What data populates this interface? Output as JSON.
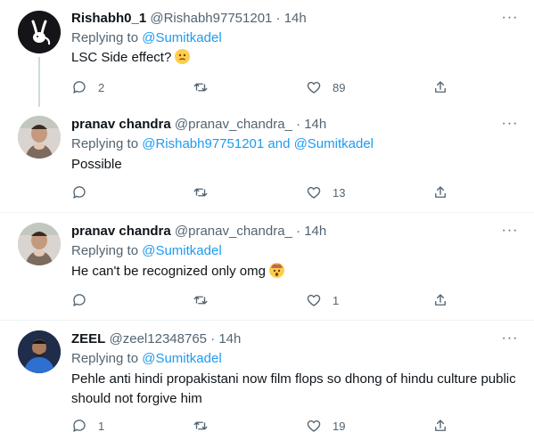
{
  "tweets": [
    {
      "name": "Rishabh0_1",
      "handle": "@Rishabh97751201",
      "dot": "·",
      "time": "14h",
      "replying_prefix": "Replying to ",
      "replying_to": "@Sumitkadel",
      "text": "LSC Side effect?",
      "emoji": "confused-face",
      "reply_count": "2",
      "retweet_count": "",
      "like_count": "89"
    },
    {
      "name": "pranav chandra",
      "handle": "@pranav_chandra_",
      "dot": "·",
      "time": "14h",
      "replying_prefix": "Replying to ",
      "replying_to": "@Rishabh97751201 and @Sumitkadel",
      "text": "Possible",
      "reply_count": "",
      "retweet_count": "",
      "like_count": "13"
    },
    {
      "name": "pranav chandra",
      "handle": "@pranav_chandra_",
      "dot": "·",
      "time": "14h",
      "replying_prefix": "Replying to ",
      "replying_to": "@Sumitkadel",
      "text": "He can't be recognized only omg",
      "emoji": "exploding-head",
      "reply_count": "",
      "retweet_count": "",
      "like_count": "1"
    },
    {
      "name": "ZEEL",
      "handle": "@zeel12348765",
      "dot": "·",
      "time": "14h",
      "replying_prefix": "Replying to ",
      "replying_to": "@Sumitkadel",
      "text": "Pehle anti hindi propakistani now film flops so dhong of hindu culture public should not forgive him",
      "reply_count": "1",
      "retweet_count": "",
      "like_count": "19"
    }
  ],
  "more_label": "···",
  "colors": {
    "link": "#1d9bf0",
    "muted": "#536471",
    "text": "#0f1419",
    "divider": "#eff3f4"
  }
}
